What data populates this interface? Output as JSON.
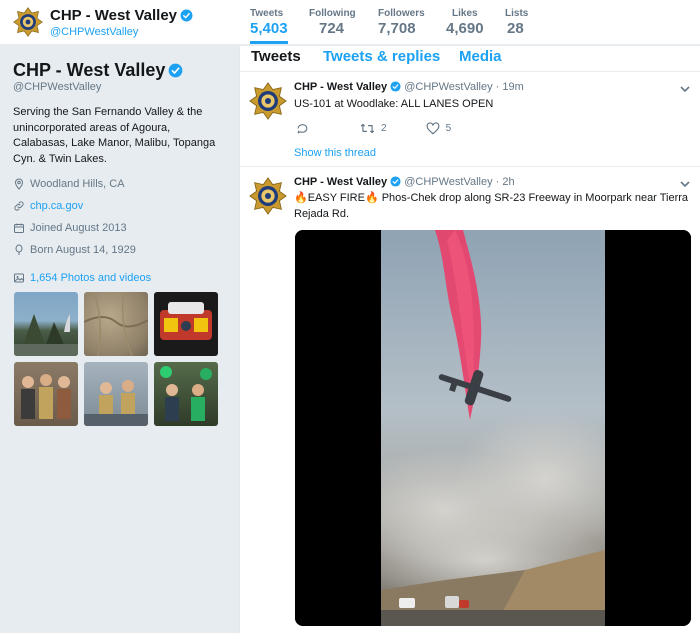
{
  "profile": {
    "name": "CHP - West Valley",
    "handle": "@CHPWestValley",
    "bio": "Serving the San Fernando Valley & the unincorporated areas of Agoura, Calabasas, Lake Manor, Malibu, Topanga Cyn. & Twin Lakes.",
    "location": "Woodland Hills, CA",
    "website": "chp.ca.gov",
    "joined": "Joined August 2013",
    "born": "Born August 14, 1929",
    "photos_label": "1,654 Photos and videos"
  },
  "stats": [
    {
      "label": "Tweets",
      "value": "5,403"
    },
    {
      "label": "Following",
      "value": "724"
    },
    {
      "label": "Followers",
      "value": "7,708"
    },
    {
      "label": "Likes",
      "value": "4,690"
    },
    {
      "label": "Lists",
      "value": "28"
    }
  ],
  "tabs": [
    "Tweets",
    "Tweets & replies",
    "Media"
  ],
  "tweets": [
    {
      "name": "CHP - West Valley",
      "handle": "@CHPWestValley",
      "time": "· 19m",
      "text": "US-101 at Woodlake: ALL LANES OPEN",
      "retweets": "2",
      "likes": "5",
      "show_thread": "Show this thread"
    },
    {
      "name": "CHP - West Valley",
      "handle": "@CHPWestValley",
      "time": "· 2h",
      "text_line1": "🔥EASY FIRE🔥 Phos-Chek drop along SR-23 Freeway in Moorpark near Tierra",
      "text_line2": "Rejada Rd."
    }
  ],
  "colors": {
    "accent": "#1da1f2",
    "background": "#e6ecf0",
    "text": "#14171a",
    "muted": "#657786",
    "retardant": "#e8406a"
  },
  "icons": {
    "badge": "chp-badge-icon",
    "verified": "verified-icon",
    "location": "location-pin-icon",
    "link": "link-icon",
    "calendar": "calendar-icon",
    "balloon": "balloon-icon",
    "photos": "photo-icon",
    "reply": "reply-icon",
    "retweet": "retweet-icon",
    "like": "heart-icon",
    "caret": "chevron-down-icon"
  }
}
